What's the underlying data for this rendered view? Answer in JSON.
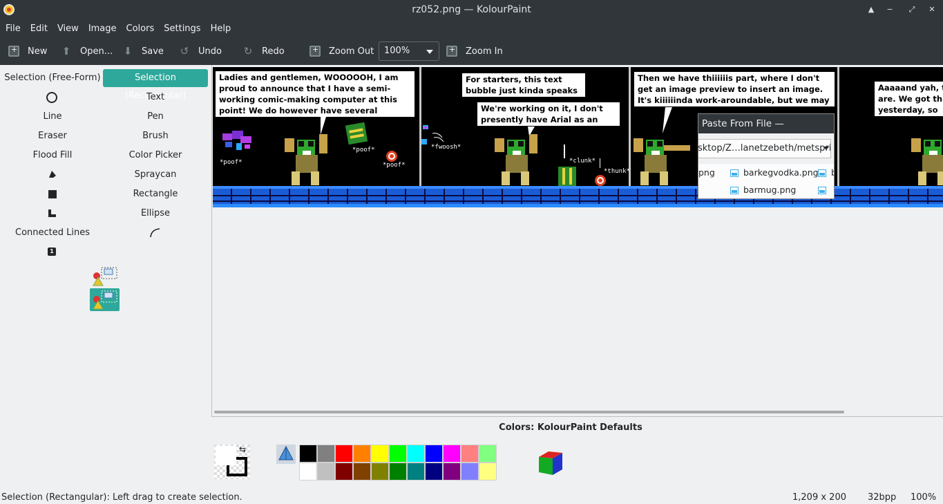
{
  "window": {
    "title": "rz052.png — KolourPaint",
    "controls": [
      "▲",
      "−",
      "⤢",
      "✕"
    ]
  },
  "menu": [
    "File",
    "Edit",
    "View",
    "Image",
    "Colors",
    "Settings",
    "Help"
  ],
  "toolbar": {
    "new_label": "New",
    "open_label": "Open...",
    "save_label": "Save",
    "undo_label": "Undo",
    "redo_label": "Redo",
    "zoom_out_label": "Zoom Out",
    "zoom_value": "100%",
    "zoom_in_label": "Zoom In"
  },
  "tools": {
    "selection_freeform": "Selection (Free-Form)",
    "selection_rect": "Selection (Rectangular)",
    "text": "Text",
    "line": "Line",
    "pen": "Pen",
    "eraser": "Eraser",
    "brush": "Brush",
    "flood_fill": "Flood Fill",
    "color_picker": "Color Picker",
    "spraycan": "Spraycan",
    "rectangle": "Rectangle",
    "ellipse": "Ellipse",
    "connected_lines": "Connected Lines",
    "active": "Selection (Rectangular)"
  },
  "comic": {
    "panel1_bubble": "Ladies and gentlemen, WOOOOOH, I am proud to announce that I have a semi-working comic-making computer at this point! We do however have several hurdles left to jump.",
    "panel1_sfx1": "*poof*",
    "panel1_sfx2": "*poof*",
    "panel1_sfx3": "*poof*",
    "panel2_bubble1": "For starters, this text bubble just kinda speaks for itself.",
    "panel2_bubble2": "We're working on it, I don't presently have Arial as an option.",
    "panel2_sfx1": "*fwoosh*",
    "panel2_sfx2": "*clunk*",
    "panel2_sfx3": "*thunk*",
    "panel3_bubble": "Then we have thiiiiiis part, where I don't get an image preview to insert an image. It's kiiiiiinda work-aroundable, but we may want a new app.",
    "panel4_bubble": "Aaaaand yah, th are. We got this yesterday, so we"
  },
  "dialog": {
    "title": "Paste From File — KolourPaint",
    "path": "sktop/Z…lanetzebeth/metsprite",
    "file_left_1": "png",
    "file_1": "barkegvodka.png",
    "file_2": "barmug.png",
    "file_right_1": "b"
  },
  "colors": {
    "title": "Colors: KolourPaint Defaults",
    "top_row": [
      "#000000",
      "#808080",
      "#ff0000",
      "#ff8000",
      "#ffff00",
      "#00ff00",
      "#00ffff",
      "#0000ff",
      "#ff00ff",
      "#ff8080",
      "#80ff80"
    ],
    "bottom_row": [
      "#ffffff",
      "#c0c0c0",
      "#800000",
      "#804000",
      "#808000",
      "#008000",
      "#008080",
      "#000080",
      "#800080",
      "#8080ff",
      "#ffff80"
    ]
  },
  "status": {
    "message": "Selection (Rectangular): Left drag to create selection.",
    "dimensions": "1,209 x 200",
    "depth": "32bpp",
    "zoom": "100%"
  }
}
